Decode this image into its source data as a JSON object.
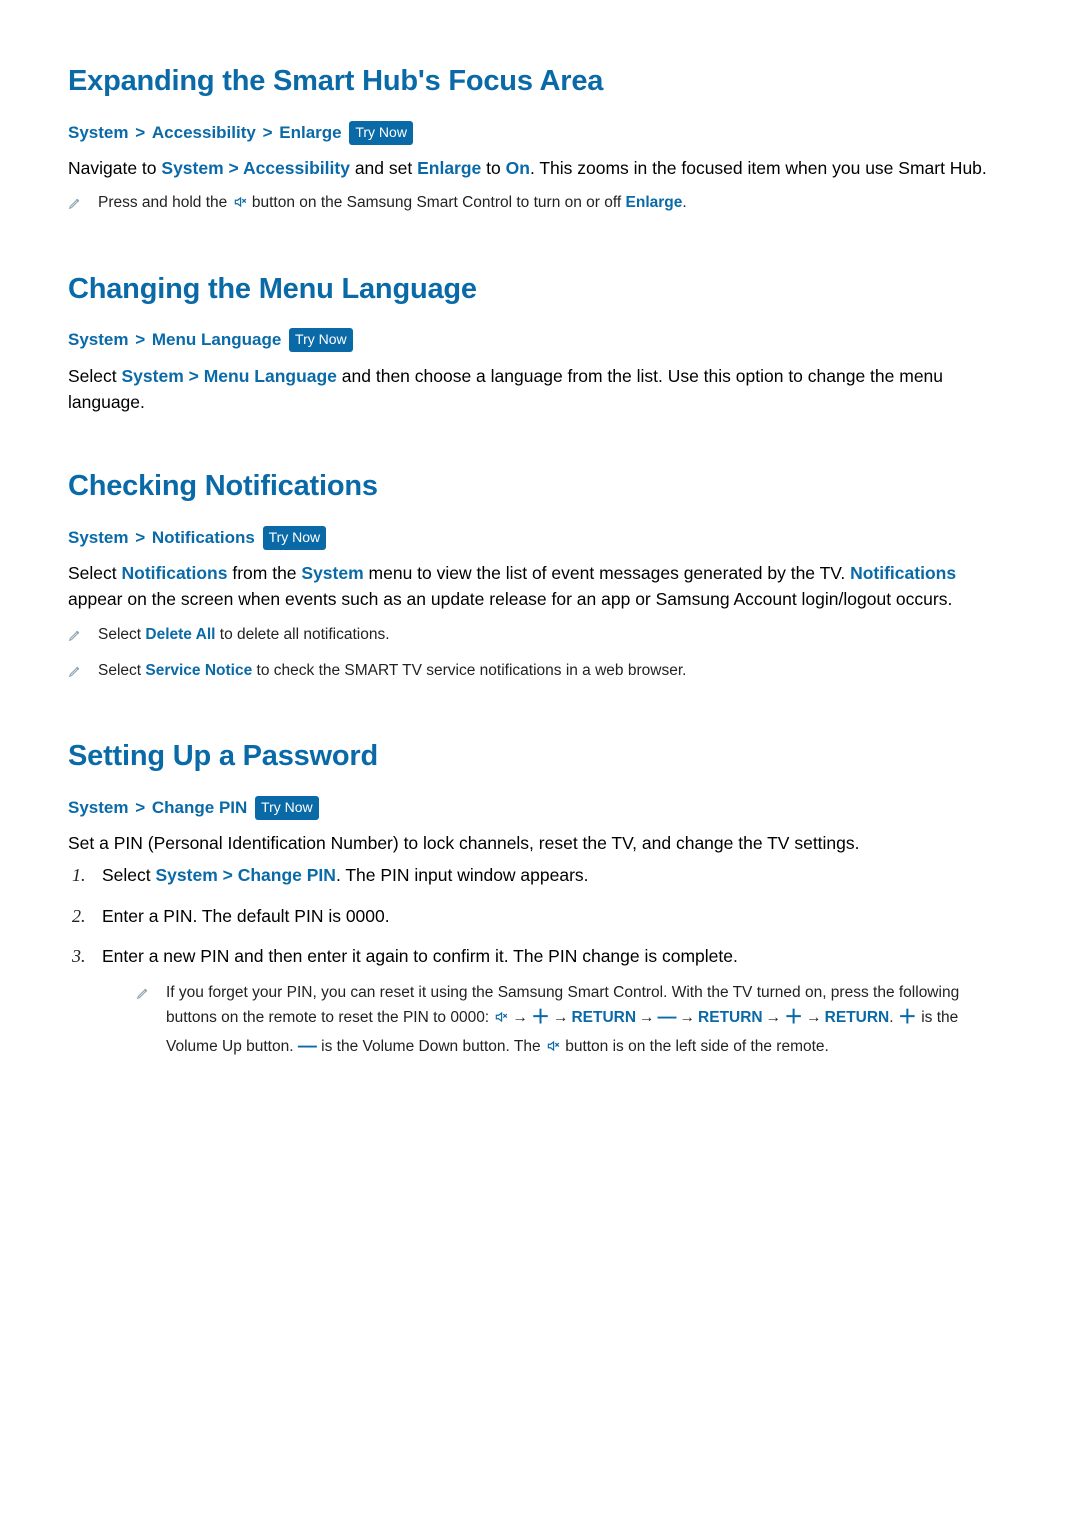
{
  "sections": {
    "expand": {
      "heading": "Expanding the Smart Hub's Focus Area",
      "breadcrumb": {
        "a": "System",
        "b": "Accessibility",
        "c": "Enlarge",
        "try": "Try Now"
      },
      "p1_pre": "Navigate to ",
      "p1_k1": "System",
      "p1_sep": " > ",
      "p1_k2": "Accessibility",
      "p1_mid": " and set ",
      "p1_k3": "Enlarge",
      "p1_mid2": " to ",
      "p1_k4": "On",
      "p1_post": ". This zooms in the focused item when you use Smart Hub.",
      "note1_pre": "Press and hold the ",
      "note1_mid": " button on the Samsung Smart Control to turn on or off ",
      "note1_kw": "Enlarge",
      "note1_post": "."
    },
    "lang": {
      "heading": "Changing the Menu Language",
      "breadcrumb": {
        "a": "System",
        "b": "Menu Language",
        "try": "Try Now"
      },
      "p1_pre": "Select ",
      "p1_k1": "System",
      "p1_sep": " > ",
      "p1_k2": "Menu Language",
      "p1_post": " and then choose a language from the list. Use this option to change the menu language."
    },
    "notif": {
      "heading": "Checking Notifications",
      "breadcrumb": {
        "a": "System",
        "b": "Notifications",
        "try": "Try Now"
      },
      "p1_pre": "Select ",
      "p1_k1": "Notifications",
      "p1_mid": " from the ",
      "p1_k2": "System",
      "p1_mid2": " menu to view the list of event messages generated by the TV. ",
      "p1_k3": "Notifications",
      "p1_post": " appear on the screen when events such as an update release for an app or Samsung Account login/logout occurs.",
      "note1_pre": "Select ",
      "note1_kw": "Delete All",
      "note1_post": " to delete all notifications.",
      "note2_pre": "Select ",
      "note2_kw": "Service Notice",
      "note2_post": " to check the SMART TV service notifications in a web browser."
    },
    "pin": {
      "heading": "Setting Up a Password",
      "breadcrumb": {
        "a": "System",
        "b": "Change PIN",
        "try": "Try Now"
      },
      "intro": "Set a PIN (Personal Identification Number) to lock channels, reset the TV, and change the TV settings.",
      "steps": {
        "s1_pre": "Select ",
        "s1_k1": "System",
        "s1_sep": " > ",
        "s1_k2": "Change PIN",
        "s1_post": ". The PIN input window appears.",
        "s2": "Enter a PIN. The default PIN is 0000.",
        "s3": "Enter a new PIN and then enter it again to confirm it. The PIN change is complete."
      },
      "resetnote": {
        "pre": "If you forget your PIN, you can reset it using the Samsung Smart Control. With the TV turned on, press the following buttons on the remote to reset the PIN to 0000: ",
        "seq_return": "RETURN",
        "mid1": ". ",
        "plus_desc_pre": "",
        "plus_desc": " is the Volume Up button. ",
        "minus_desc": " is the Volume Down button. The ",
        "tail": " button is on the left side of the remote."
      }
    }
  }
}
